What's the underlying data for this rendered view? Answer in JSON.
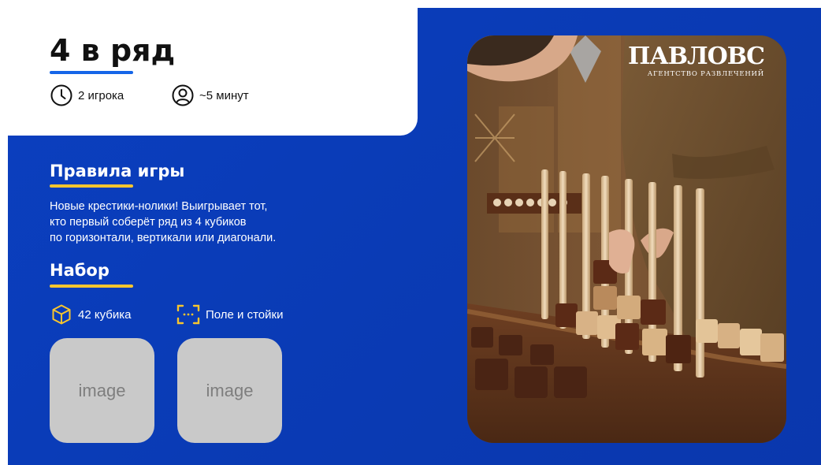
{
  "header": {
    "title": "4 в ряд",
    "players": {
      "icon": "clock-icon",
      "text": "2 игрока"
    },
    "duration": {
      "icon": "person-icon",
      "text": "~5 минут"
    }
  },
  "rules": {
    "title": "Правила игры",
    "lines": [
      "Новые крестики-нолики! Выигрывает тот,",
      "кто первый соберёт ряд из 4 кубиков",
      "по горизонтали, вертикали или диагонали."
    ]
  },
  "kit": {
    "title": "Набор",
    "items": [
      {
        "icon": "cube-icon",
        "text": "42 кубика"
      },
      {
        "icon": "frame-icon",
        "text": "Поле и стойки"
      }
    ],
    "placeholders": [
      "image",
      "image"
    ]
  },
  "photo": {
    "logo_main": "ПАВЛОВС",
    "logo_sub": "АГЕНТСТВО РАЗВЛЕЧЕНИЙ"
  },
  "colors": {
    "background": "#0b3fc0",
    "title_accent": "#1565e8",
    "section_accent": "#f7c52e",
    "placeholder": "#c9c9c9"
  }
}
